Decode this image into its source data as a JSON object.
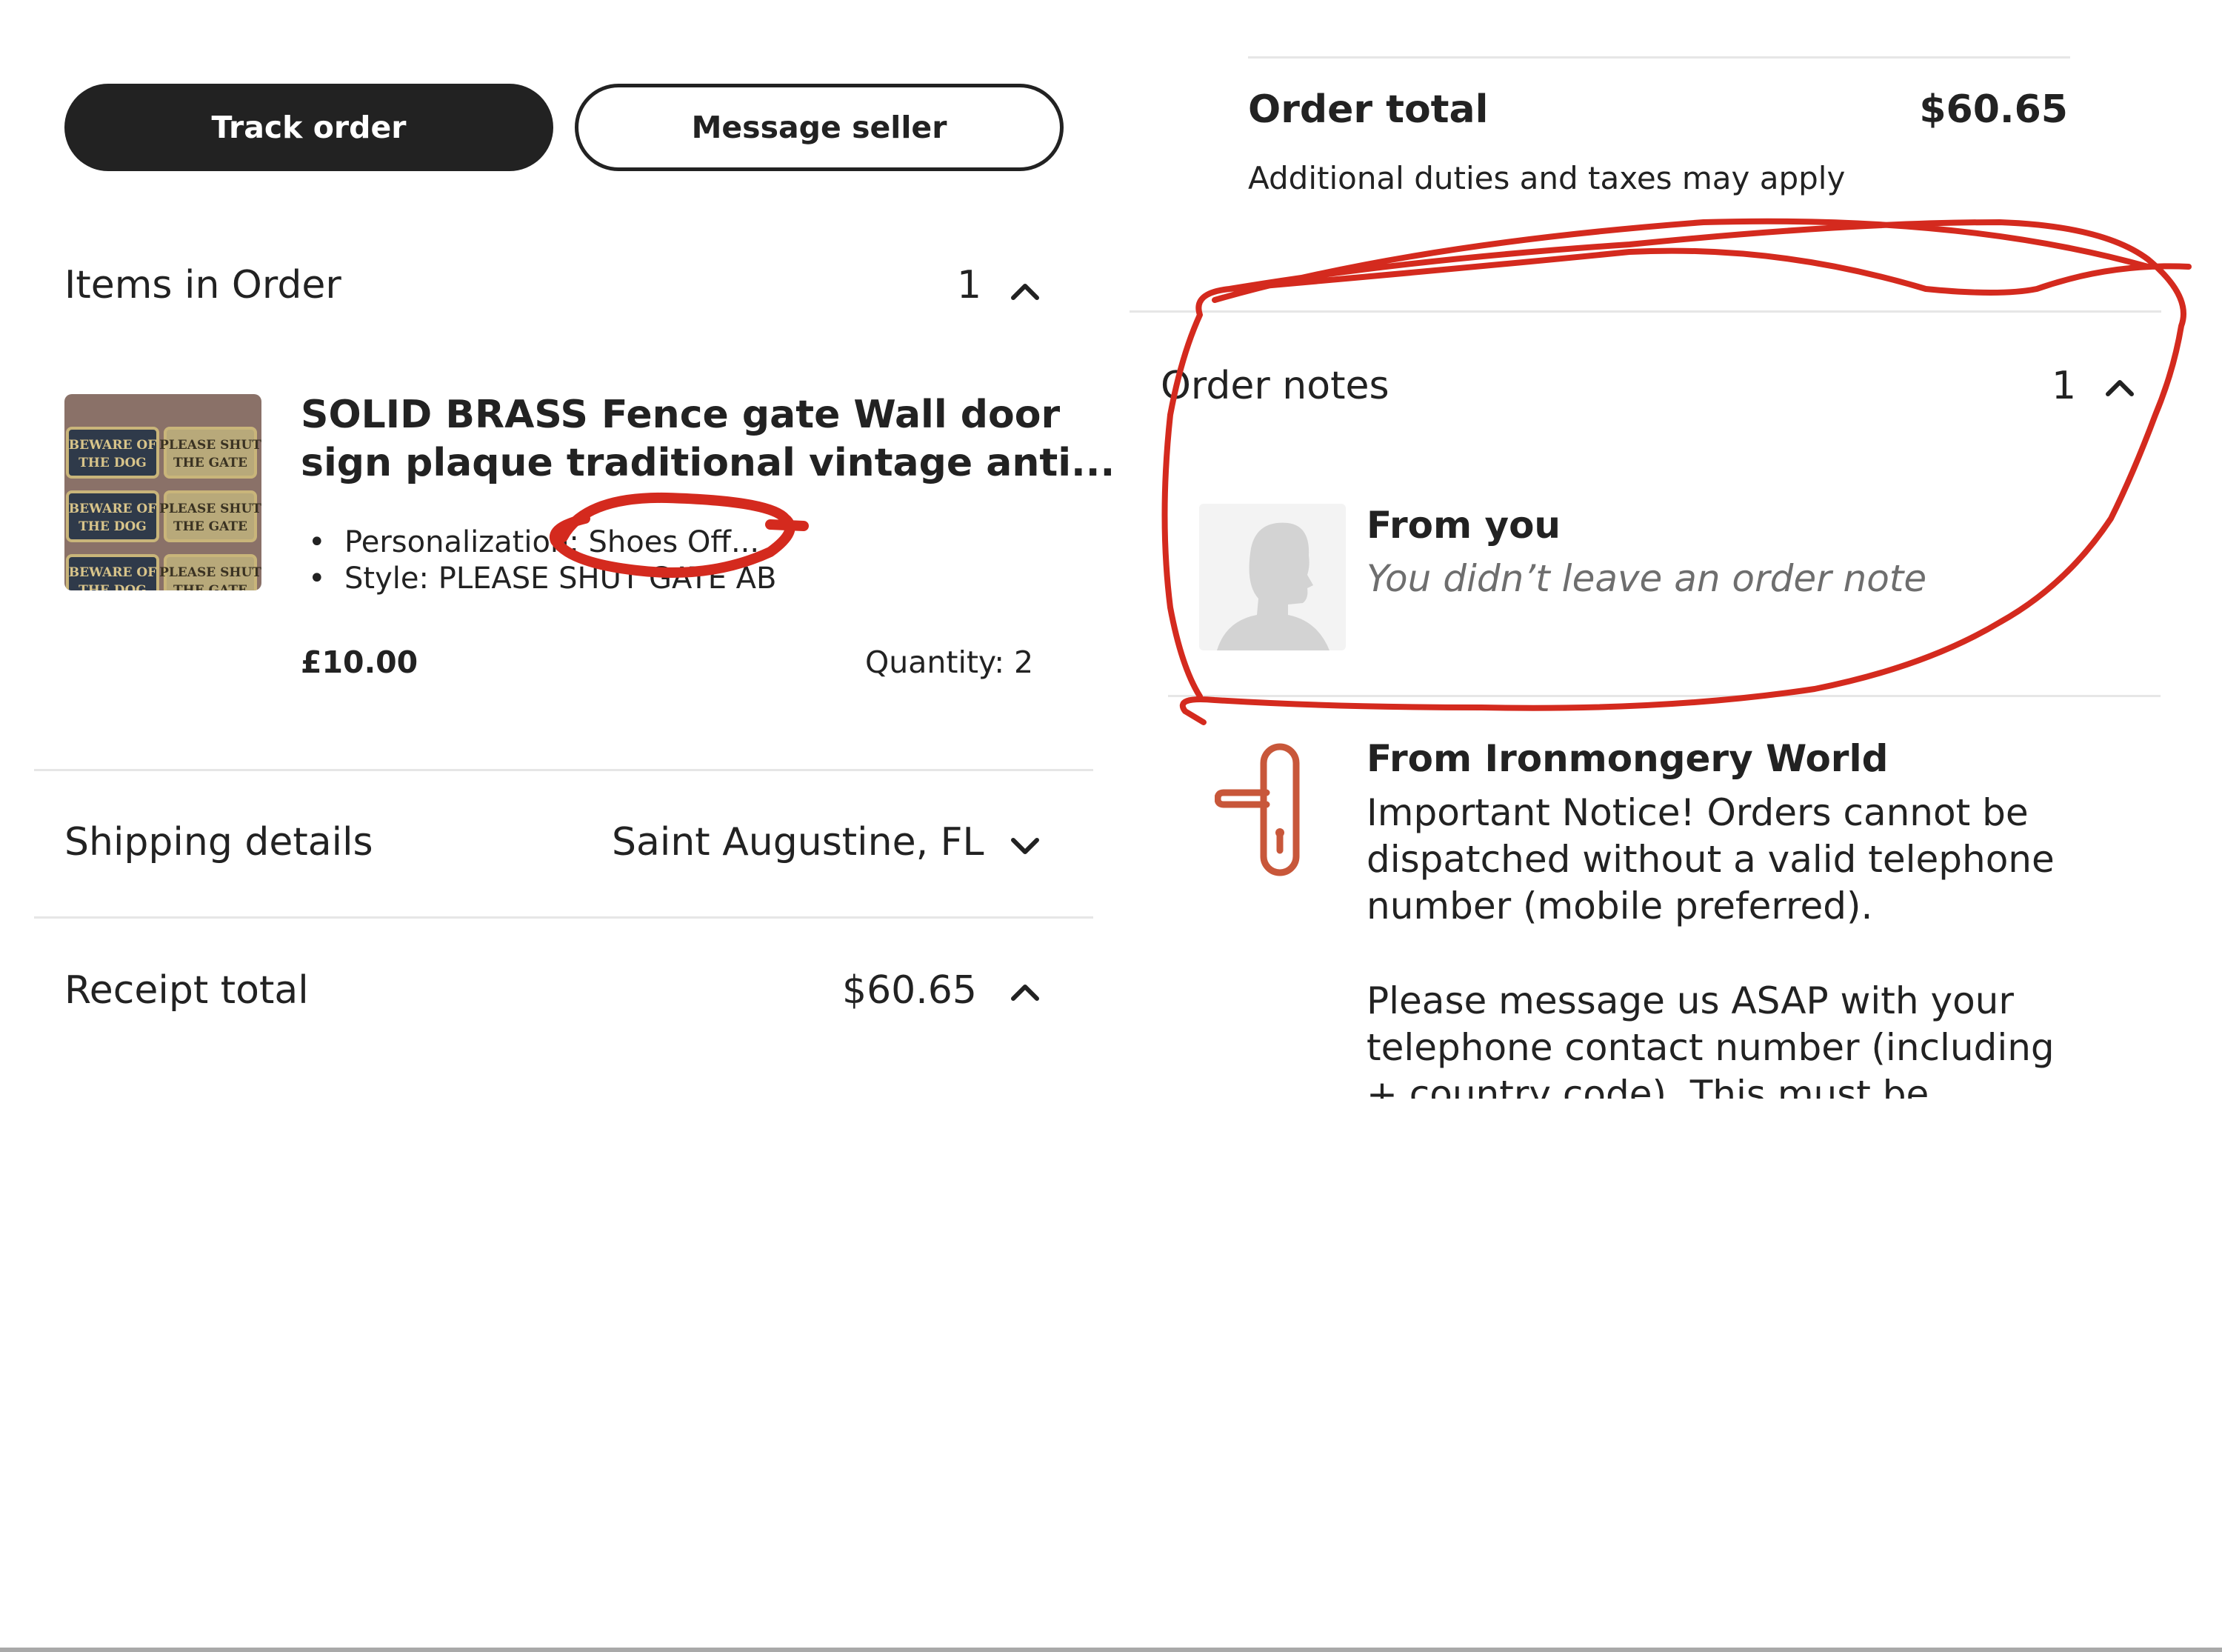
{
  "buttons": {
    "track_order": "Track order",
    "message_seller": "Message seller"
  },
  "items_section": {
    "title": "Items in Order",
    "count": "1"
  },
  "item": {
    "title_line1": "SOLID BRASS Fence gate Wall door",
    "title_line2": "sign plaque traditional vintage anti...",
    "personalization_label": "Personalization:",
    "personalization_value": "Shoes Off...",
    "style": "Style: PLEASE SHUT GATE AB",
    "price": "£10.00",
    "quantity": "Quantity: 2",
    "thumbnail_plaques": [
      [
        "BEWARE OF",
        "THE DOG"
      ],
      [
        "PLEASE SHUT",
        "THE GATE"
      ],
      [
        "BEWARE OF",
        "THE DOG"
      ],
      [
        "PLEASE SHUT",
        "THE GATE"
      ],
      [
        "BEWARE OF",
        "THE DOG"
      ],
      [
        "PLEASE SHUT",
        "THE GATE"
      ]
    ]
  },
  "shipping": {
    "label": "Shipping details",
    "value": "Saint Augustine, FL"
  },
  "receipt": {
    "label": "Receipt total",
    "value": "$60.65"
  },
  "order_total": {
    "label": "Order total",
    "value": "$60.65",
    "note": "Additional duties and taxes may apply"
  },
  "order_notes": {
    "title": "Order notes",
    "count": "1",
    "from_you_label": "From you",
    "from_you_text": "You didn’t leave an order note"
  },
  "seller_note": {
    "from_label": "From Ironmongery World",
    "paragraph1": [
      "Important Notice!  Orders cannot be",
      "dispatched without a valid telephone",
      "number (mobile preferred)."
    ],
    "paragraph2": [
      "Please message us ASAP with your",
      "telephone contact number (including",
      "+ country code).  This must be"
    ]
  },
  "colors": {
    "dark_button": "#222222",
    "divider": "#e6e6e6",
    "annotation_red": "#d42a1e",
    "seller_icon": "#c8573a",
    "muted_text": "#6e6e6e"
  },
  "icons": {
    "collapse": "chevron-up-icon",
    "expand": "chevron-down-icon",
    "avatar": "person-silhouette-icon",
    "seller": "door-handle-icon"
  }
}
